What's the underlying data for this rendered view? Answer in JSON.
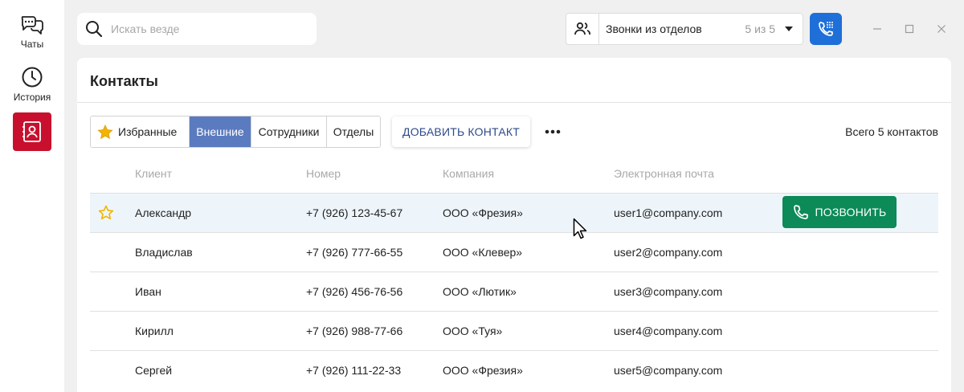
{
  "rail": {
    "chats_label": "Чаты",
    "history_label": "История",
    "chats_icon": "chat-bubbles-icon",
    "history_icon": "clock-icon",
    "contacts_icon": "contact-card-icon",
    "active_color": "#c8102e"
  },
  "search": {
    "placeholder": "Искать везде",
    "value": ""
  },
  "dept_select": {
    "label": "Звонки из отделов",
    "count": "5 из 5"
  },
  "colors": {
    "call_blue": "#1f6fd8",
    "tab_active": "#5b7bc0",
    "call_green": "#0c8a57",
    "row_highlight": "#eef5fa",
    "star": "#f2b400"
  },
  "contacts": {
    "title": "Контакты",
    "tabs": [
      "Избранные",
      "Внешние",
      "Сотрудники",
      "Отделы"
    ],
    "active_tab": "Внешние",
    "add_button": "ДОБАВИТЬ КОНТАКТ",
    "total": "Всего 5 контактов",
    "columns": [
      "Клиент",
      "Номер",
      "Компания",
      "Электронная почта"
    ],
    "rows": [
      {
        "name": "Александр",
        "number": "+7 (926) 123-45-67",
        "company": "ООО «Фрезия»",
        "email": "user1@company.com",
        "starred": false,
        "highlighted": true
      },
      {
        "name": "Владислав",
        "number": "+7 (926) 777-66-55",
        "company": "ООО «Клевер»",
        "email": "user2@company.com",
        "starred": false,
        "highlighted": false
      },
      {
        "name": "Иван",
        "number": "+7 (926) 456-76-56",
        "company": "ООО «Лютик»",
        "email": "user3@company.com",
        "starred": false,
        "highlighted": false
      },
      {
        "name": "Кирилл",
        "number": "+7 (926) 988-77-66",
        "company": "ООО «Туя»",
        "email": "user4@company.com",
        "starred": false,
        "highlighted": false
      },
      {
        "name": "Сергей",
        "number": "+7 (926) 111-22-33",
        "company": "ООО «Фрезия»",
        "email": "user5@company.com",
        "starred": false,
        "highlighted": false
      }
    ],
    "call_button": "ПОЗВОНИТЬ"
  }
}
